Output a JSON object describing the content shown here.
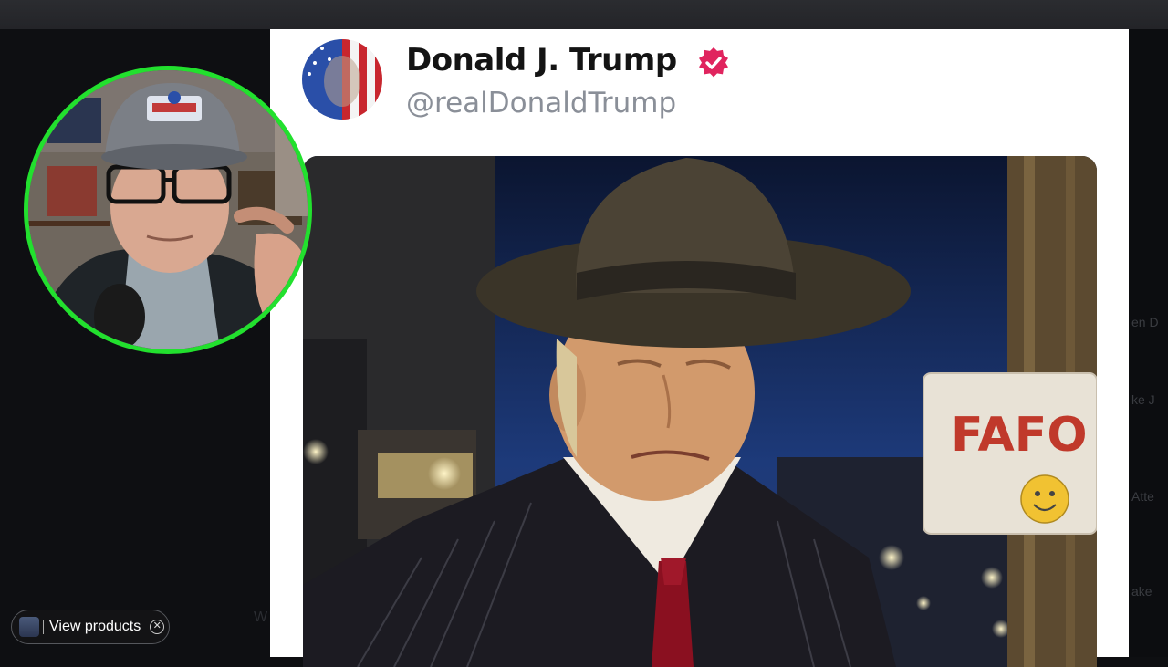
{
  "post": {
    "display_name": "Donald J. Trump",
    "handle": "@realDonaldTrump",
    "verified": true,
    "badge_color": "#e0245e",
    "image": {
      "sign_text": "FAFO",
      "description_icon": "photo"
    }
  },
  "overlay": {
    "products_label": "View products",
    "close_icon": "close-icon",
    "ring_color": "#22e02e"
  },
  "background_text": {
    "right_1": "en D",
    "right_2": "ke J",
    "right_3": "Atte",
    "right_4": "ake",
    "left_1": "W"
  }
}
